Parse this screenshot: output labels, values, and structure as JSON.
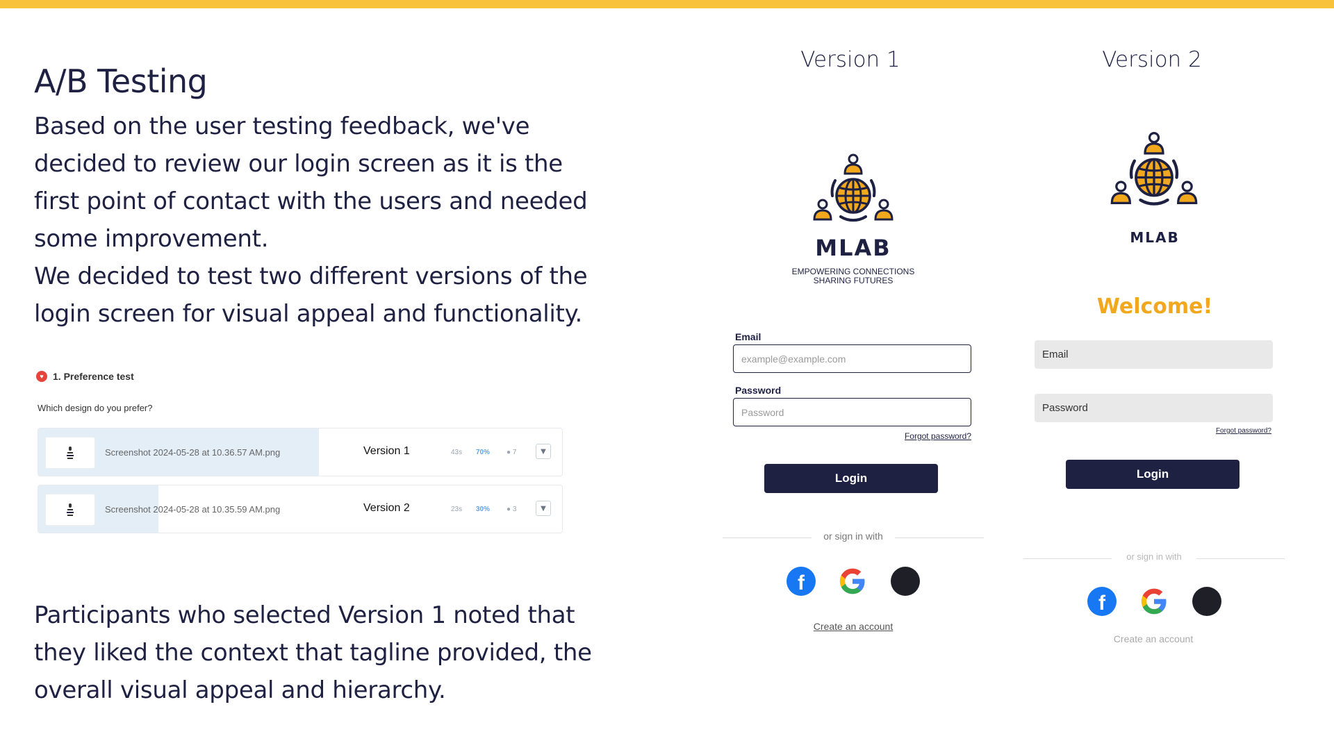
{
  "slide": {
    "title": "A/B Testing",
    "paragraph1": "Based on the user testing feedback, we've decided to review our login screen as it is the first point of contact with the users and needed some improvement.",
    "paragraph2": "We decided to test two different versions of the login screen for visual appeal and functionality.",
    "paragraph3": "Participants who selected Version 1 noted that they liked the context that tagline provided, the overall visual appeal and hierarchy."
  },
  "preference_test": {
    "heading": "1. Preference test",
    "question": "Which design do you prefer?",
    "rows": [
      {
        "file": "Screenshot 2024-05-28 at 10.36.57 AM.png",
        "label": "Version 1",
        "time": "43s",
        "percent": "70%",
        "votes": "7",
        "share": 0.7
      },
      {
        "file": "Screenshot 2024-05-28 at 10.35.59 AM.png",
        "label": "Version 2",
        "time": "23s",
        "percent": "30%",
        "votes": "3",
        "share": 0.3
      }
    ],
    "dropdown_icon": "chevron-down-icon"
  },
  "version1": {
    "heading": "Version 1",
    "brand": "MLAB",
    "tagline_line1": "EMPOWERING CONNECTIONS",
    "tagline_line2": "SHARING FUTURES",
    "email_label": "Email",
    "email_placeholder": "example@example.com",
    "password_label": "Password",
    "password_placeholder": "Password",
    "forgot": "Forgot password?",
    "login": "Login",
    "or_sign_in": "or sign in with",
    "create_account": "Create an account"
  },
  "version2": {
    "heading": "Version 2",
    "brand": "MLAB",
    "welcome": "Welcome!",
    "email_placeholder": "Email",
    "password_placeholder": "Password",
    "forgot": "Forgot password?",
    "login": "Login",
    "or_sign_in": "or sign in with",
    "create_account": "Create an account"
  },
  "social": {
    "facebook_letter": "f",
    "apple_glyph": ""
  },
  "colors": {
    "accent_yellow": "#f8c33b",
    "navy": "#1f2143",
    "welcome_orange": "#f2a81d",
    "logo_orange": "#f2a81d"
  }
}
